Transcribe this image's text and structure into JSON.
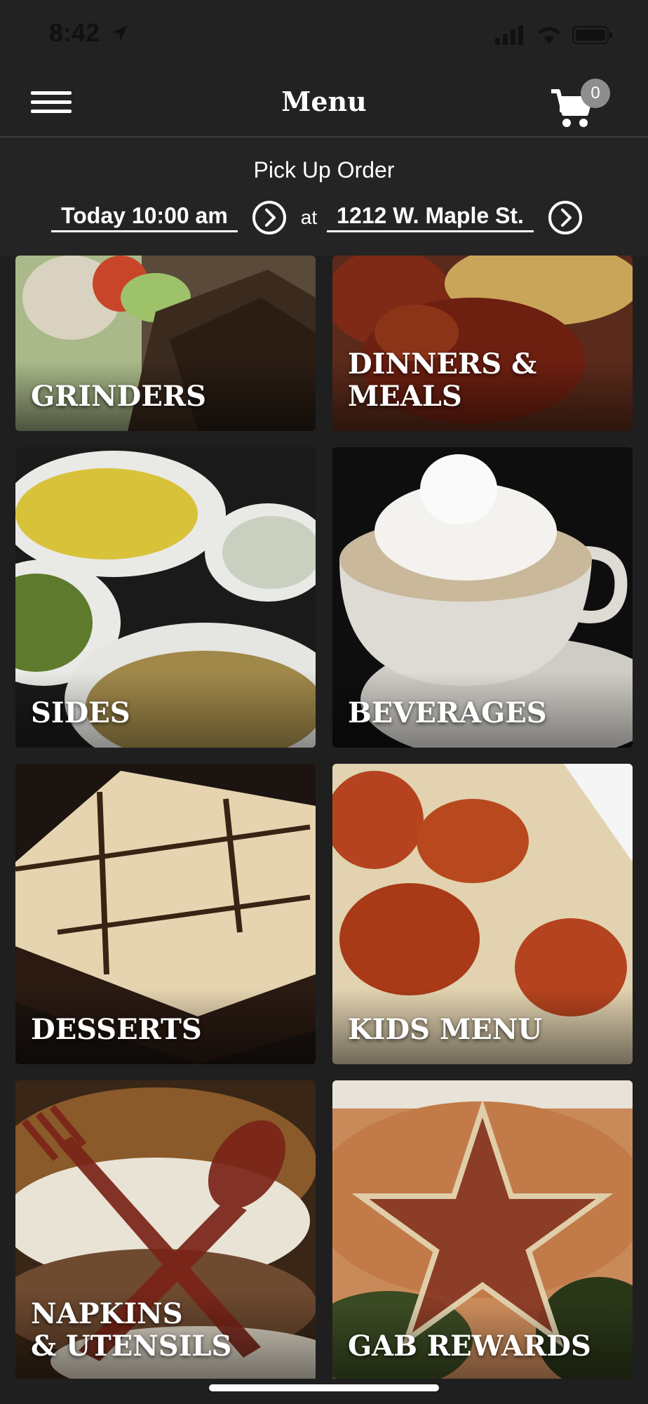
{
  "status": {
    "time": "8:42"
  },
  "nav": {
    "title": "Menu",
    "cart_count": "0"
  },
  "pickup": {
    "title": "Pick Up Order",
    "time_label": "Today 10:00 am",
    "at_label": "at",
    "location_label": "1212 W. Maple St."
  },
  "categories": [
    {
      "label": "GRINDERS"
    },
    {
      "label": "DINNERS & MEALS"
    },
    {
      "label": "SIDES"
    },
    {
      "label": "BEVERAGES"
    },
    {
      "label": "DESSERTS"
    },
    {
      "label": "KIDS MENU"
    },
    {
      "label": "NAPKINS\n& UTENSILS"
    },
    {
      "label": "GAB REWARDS"
    }
  ]
}
